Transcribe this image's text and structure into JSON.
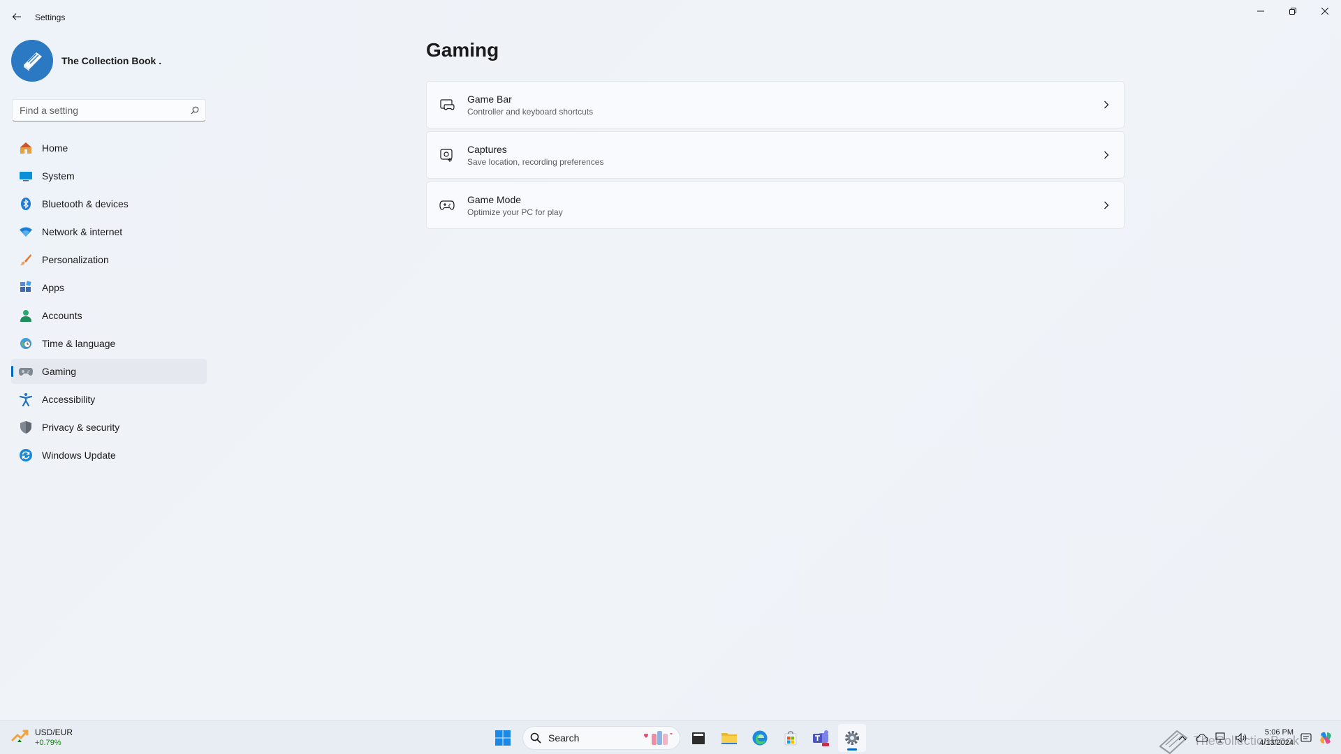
{
  "window": {
    "title": "Settings"
  },
  "profile": {
    "name": "The Collection Book ."
  },
  "search": {
    "placeholder": "Find a setting"
  },
  "nav": {
    "items": [
      {
        "label": "Home",
        "icon": "home-icon"
      },
      {
        "label": "System",
        "icon": "monitor-icon"
      },
      {
        "label": "Bluetooth & devices",
        "icon": "bluetooth-icon"
      },
      {
        "label": "Network & internet",
        "icon": "wifi-icon"
      },
      {
        "label": "Personalization",
        "icon": "brush-icon"
      },
      {
        "label": "Apps",
        "icon": "apps-icon"
      },
      {
        "label": "Accounts",
        "icon": "person-icon"
      },
      {
        "label": "Time & language",
        "icon": "globe-clock-icon"
      },
      {
        "label": "Gaming",
        "icon": "gamepad-icon",
        "active": true
      },
      {
        "label": "Accessibility",
        "icon": "accessibility-icon"
      },
      {
        "label": "Privacy & security",
        "icon": "shield-icon"
      },
      {
        "label": "Windows Update",
        "icon": "update-icon"
      }
    ]
  },
  "main": {
    "title": "Gaming",
    "cards": [
      {
        "title": "Game Bar",
        "subtitle": "Controller and keyboard shortcuts",
        "icon": "game-bar-icon"
      },
      {
        "title": "Captures",
        "subtitle": "Save location, recording preferences",
        "icon": "capture-icon"
      },
      {
        "title": "Game Mode",
        "subtitle": "Optimize your PC for play",
        "icon": "gamepad-icon"
      }
    ]
  },
  "taskbar": {
    "widget": {
      "title": "USD/EUR",
      "value": "+0.79%"
    },
    "search_label": "Search",
    "apps": [
      "start-icon",
      "file-manager-icon",
      "folder-icon",
      "edge-icon",
      "store-icon",
      "teams-icon",
      "settings-icon"
    ],
    "watermark": "TheCollectionBook",
    "clock": {
      "time": "5:06 PM",
      "date": "4/13/2024"
    }
  },
  "colors": {
    "accent": "#0067c0",
    "positive": "#0f7b0f"
  }
}
